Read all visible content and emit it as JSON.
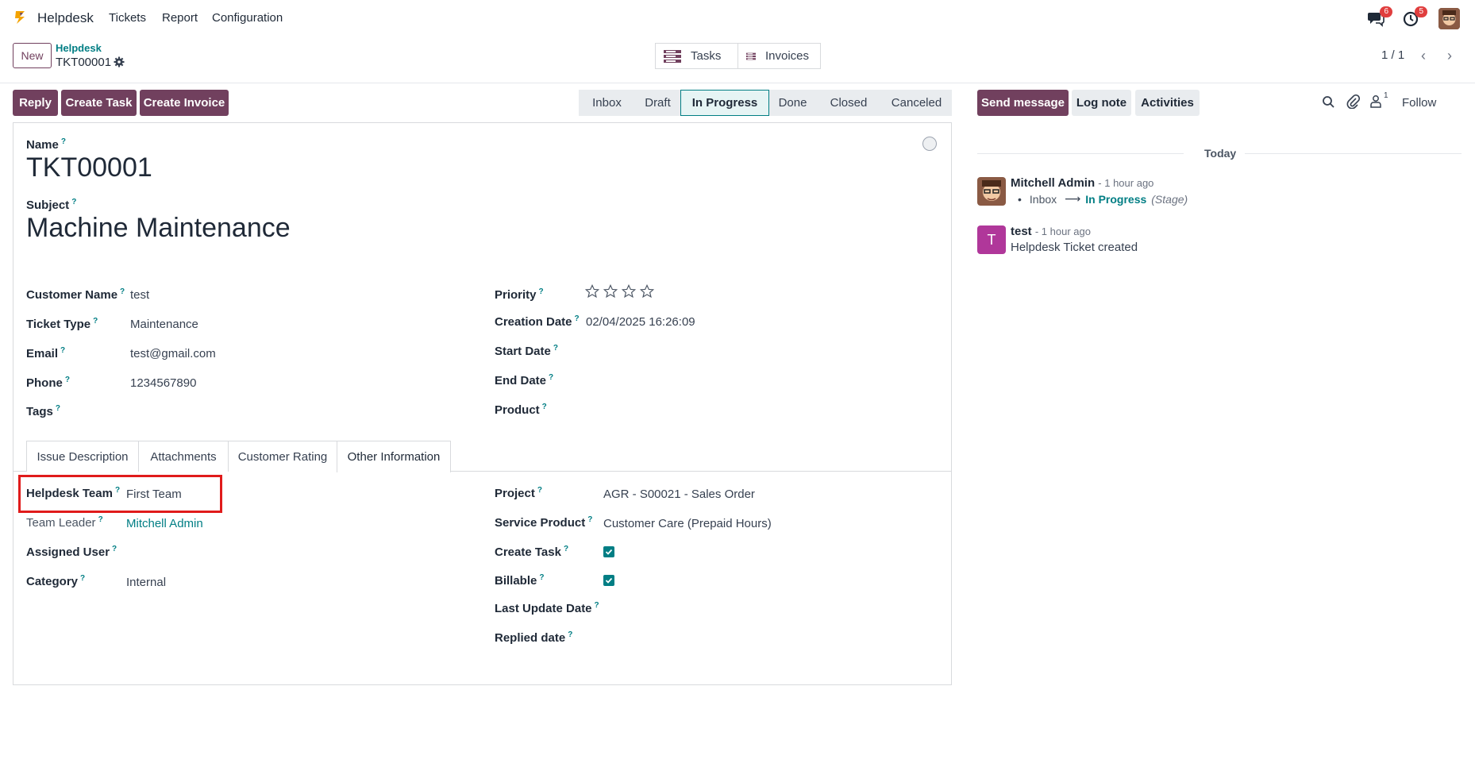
{
  "nav": {
    "app_name": "Helpdesk",
    "menu": [
      "Tickets",
      "Report",
      "Configuration"
    ],
    "chat_badge": "6",
    "activity_badge": "5"
  },
  "control": {
    "new_label": "New",
    "breadcrumb_parent": "Helpdesk",
    "breadcrumb_current": "TKT00001",
    "smart_buttons": [
      "Tasks",
      "Invoices"
    ],
    "pager": "1 / 1"
  },
  "actions": [
    "Reply",
    "Create Task",
    "Create Invoice"
  ],
  "stages": [
    "Inbox",
    "Draft",
    "In Progress",
    "Done",
    "Closed",
    "Canceled"
  ],
  "active_stage": "In Progress",
  "form": {
    "name_label": "Name",
    "name_value": "TKT00001",
    "subject_label": "Subject",
    "subject_value": "Machine Maintenance",
    "left": [
      {
        "label": "Customer Name",
        "value": "test"
      },
      {
        "label": "Ticket Type",
        "value": "Maintenance"
      },
      {
        "label": "Email",
        "value": "test@gmail.com"
      },
      {
        "label": "Phone",
        "value": "1234567890"
      },
      {
        "label": "Tags",
        "value": ""
      }
    ],
    "right": [
      {
        "label": "Priority",
        "value": ""
      },
      {
        "label": "Creation Date",
        "value": "02/04/2025 16:26:09"
      },
      {
        "label": "Start Date",
        "value": ""
      },
      {
        "label": "End Date",
        "value": ""
      },
      {
        "label": "Product",
        "value": ""
      }
    ],
    "priority_stars": 0,
    "priority_max": 4,
    "tabs": [
      "Issue Description",
      "Attachments",
      "Customer Rating",
      "Other Information"
    ],
    "active_tab": "Other Information",
    "other_left": [
      {
        "label": "Helpdesk Team",
        "value": "First Team"
      },
      {
        "label": "Team Leader",
        "value": "Mitchell Admin"
      },
      {
        "label": "Assigned User",
        "value": ""
      },
      {
        "label": "Category",
        "value": "Internal"
      }
    ],
    "other_right": [
      {
        "label": "Project",
        "value": "AGR - S00021 - Sales Order"
      },
      {
        "label": "Service Product",
        "value": "Customer Care (Prepaid Hours)"
      },
      {
        "label": "Create Task",
        "value": "checked"
      },
      {
        "label": "Billable",
        "value": "checked"
      },
      {
        "label": "Last Update Date",
        "value": ""
      },
      {
        "label": "Replied date",
        "value": ""
      }
    ]
  },
  "chatter": {
    "send_message": "Send message",
    "log_note": "Log note",
    "activities": "Activities",
    "followers_count": "1",
    "follow": "Follow",
    "date_separator": "Today",
    "messages": [
      {
        "author": "Mitchell Admin",
        "time": "- 1 hour ago",
        "from": "Inbox",
        "to": "In Progress",
        "field": "(Stage)"
      },
      {
        "author": "test",
        "time": "- 1 hour ago",
        "body": "Helpdesk Ticket created",
        "initial": "T"
      }
    ]
  },
  "colors": {
    "brand": "#71405e",
    "accent": "#017e84",
    "highlight": "#e01b1b"
  }
}
